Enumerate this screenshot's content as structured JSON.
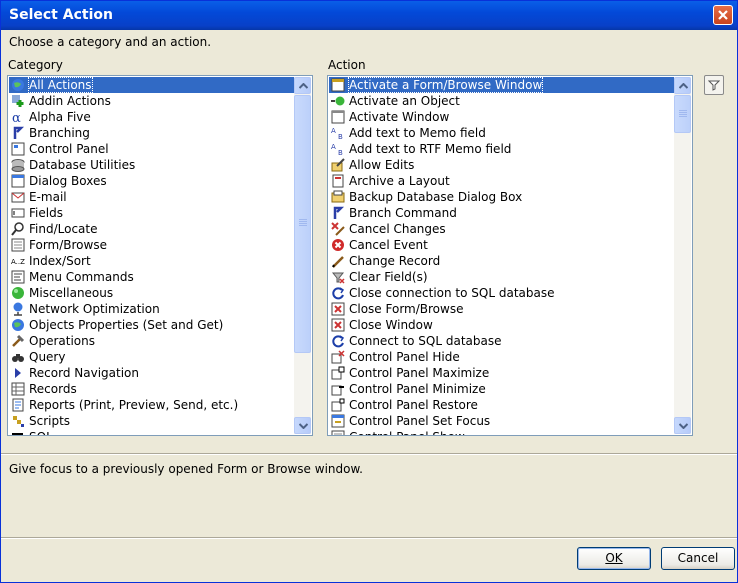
{
  "window": {
    "title": "Select Action"
  },
  "instruction": "Choose a category and an action.",
  "category": {
    "label": "Category",
    "items": [
      {
        "label": "All Actions",
        "icon": "globe-icon"
      },
      {
        "label": "Addin Actions",
        "icon": "addin-icon"
      },
      {
        "label": "Alpha Five",
        "icon": "alpha-icon"
      },
      {
        "label": "Branching",
        "icon": "branch-icon"
      },
      {
        "label": "Control Panel",
        "icon": "control-panel-icon"
      },
      {
        "label": "Database Utilities",
        "icon": "database-icon"
      },
      {
        "label": "Dialog Boxes",
        "icon": "dialog-icon"
      },
      {
        "label": "E-mail",
        "icon": "email-icon"
      },
      {
        "label": "Fields",
        "icon": "field-icon"
      },
      {
        "label": "Find/Locate",
        "icon": "find-icon"
      },
      {
        "label": "Form/Browse",
        "icon": "form-icon"
      },
      {
        "label": "Index/Sort",
        "icon": "sort-icon"
      },
      {
        "label": "Menu Commands",
        "icon": "menu-icon"
      },
      {
        "label": "Miscellaneous",
        "icon": "misc-icon"
      },
      {
        "label": "Network Optimization",
        "icon": "network-icon"
      },
      {
        "label": "Objects Properties (Set and Get)",
        "icon": "globe-icon"
      },
      {
        "label": "Operations",
        "icon": "operations-icon"
      },
      {
        "label": "Query",
        "icon": "query-icon"
      },
      {
        "label": "Record Navigation",
        "icon": "navigation-icon"
      },
      {
        "label": "Records",
        "icon": "records-icon"
      },
      {
        "label": "Reports (Print, Preview, Send, etc.)",
        "icon": "report-icon"
      },
      {
        "label": "Scripts",
        "icon": "script-icon"
      },
      {
        "label": "SQL",
        "icon": "sql-icon"
      }
    ]
  },
  "action": {
    "label": "Action",
    "items": [
      {
        "label": "Activate a Form/Browse Window",
        "icon": "form-window-icon"
      },
      {
        "label": "Activate an Object",
        "icon": "activate-object-icon"
      },
      {
        "label": "Activate Window",
        "icon": "window-icon"
      },
      {
        "label": "Add text to Memo field",
        "icon": "memo-icon"
      },
      {
        "label": "Add text to RTF Memo field",
        "icon": "rtf-memo-icon"
      },
      {
        "label": "Allow Edits",
        "icon": "edit-icon"
      },
      {
        "label": "Archive a Layout",
        "icon": "archive-icon"
      },
      {
        "label": "Backup Database Dialog Box",
        "icon": "backup-icon"
      },
      {
        "label": "Branch Command",
        "icon": "branch-icon"
      },
      {
        "label": "Cancel Changes",
        "icon": "cancel-changes-icon"
      },
      {
        "label": "Cancel Event",
        "icon": "cancel-event-icon"
      },
      {
        "label": "Change Record",
        "icon": "pencil-icon"
      },
      {
        "label": "Clear Field(s)",
        "icon": "clear-icon"
      },
      {
        "label": "Close connection to SQL database",
        "icon": "sql-connection-icon"
      },
      {
        "label": "Close Form/Browse",
        "icon": "close-form-icon"
      },
      {
        "label": "Close Window",
        "icon": "close-window-icon"
      },
      {
        "label": "Connect to SQL database",
        "icon": "sql-connection-icon"
      },
      {
        "label": "Control Panel Hide",
        "icon": "panel-hide-icon"
      },
      {
        "label": "Control Panel Maximize",
        "icon": "panel-maximize-icon"
      },
      {
        "label": "Control Panel Minimize",
        "icon": "panel-minimize-icon"
      },
      {
        "label": "Control Panel Restore",
        "icon": "panel-restore-icon"
      },
      {
        "label": "Control Panel Set Focus",
        "icon": "panel-focus-icon"
      },
      {
        "label": "Control Panel Show",
        "icon": "panel-show-icon"
      }
    ]
  },
  "description": "Give focus to a previously opened Form or Browse window.",
  "buttons": {
    "ok": "OK",
    "cancel": "Cancel"
  },
  "colors": {
    "titlebar": "#0a5fe8",
    "selection": "#316ac5",
    "face": "#ece9d8"
  }
}
